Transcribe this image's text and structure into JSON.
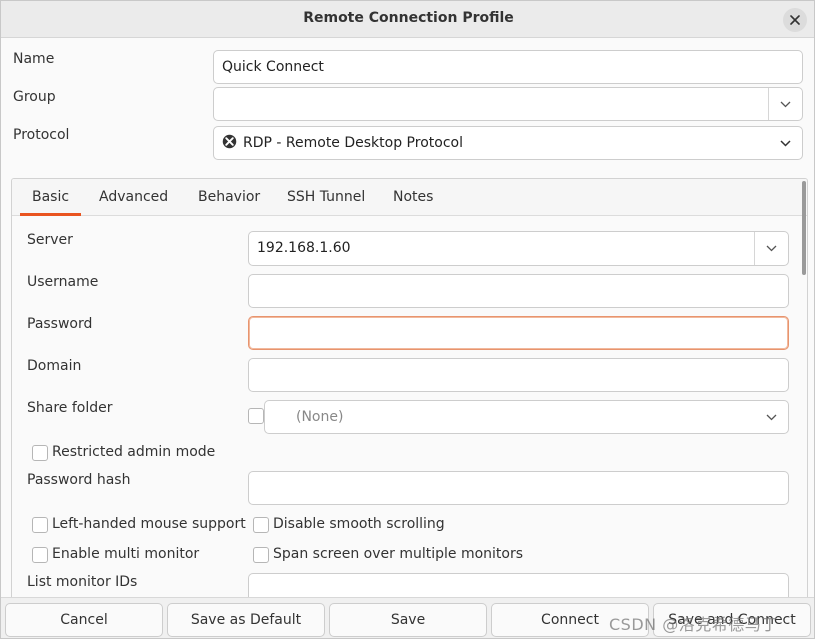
{
  "window": {
    "title": "Remote Connection Profile"
  },
  "profile": {
    "name_label": "Name",
    "name_value": "Quick Connect",
    "group_label": "Group",
    "group_value": "",
    "protocol_label": "Protocol",
    "protocol_value": "RDP - Remote Desktop Protocol"
  },
  "tabs": [
    {
      "label": "Basic",
      "active": true
    },
    {
      "label": "Advanced",
      "active": false
    },
    {
      "label": "Behavior",
      "active": false
    },
    {
      "label": "SSH Tunnel",
      "active": false
    },
    {
      "label": "Notes",
      "active": false
    }
  ],
  "basic": {
    "server_label": "Server",
    "server_value": "192.168.1.60",
    "username_label": "Username",
    "username_value": "",
    "password_label": "Password",
    "password_value": "",
    "domain_label": "Domain",
    "domain_value": "",
    "share_folder_label": "Share folder",
    "share_folder_value": "(None)",
    "restricted_admin_label": "Restricted admin mode",
    "password_hash_label": "Password hash",
    "password_hash_value": "",
    "left_handed_label": "Left-handed mouse support",
    "disable_smooth_label": "Disable smooth scrolling",
    "multi_monitor_label": "Enable multi monitor",
    "span_screen_label": "Span screen over multiple monitors",
    "monitor_ids_label": "List monitor IDs"
  },
  "footer": {
    "cancel": "Cancel",
    "save_default": "Save as Default",
    "save": "Save",
    "connect": "Connect",
    "save_connect": "Save and Connect"
  },
  "watermark": "CSDN @洛克希德马丁",
  "colors": {
    "accent": "#e95420",
    "focus_border": "#e8946e"
  },
  "icons": {
    "close": "close-icon",
    "dropdown": "chevron-down-icon",
    "protocol": "rdp-protocol-icon"
  }
}
